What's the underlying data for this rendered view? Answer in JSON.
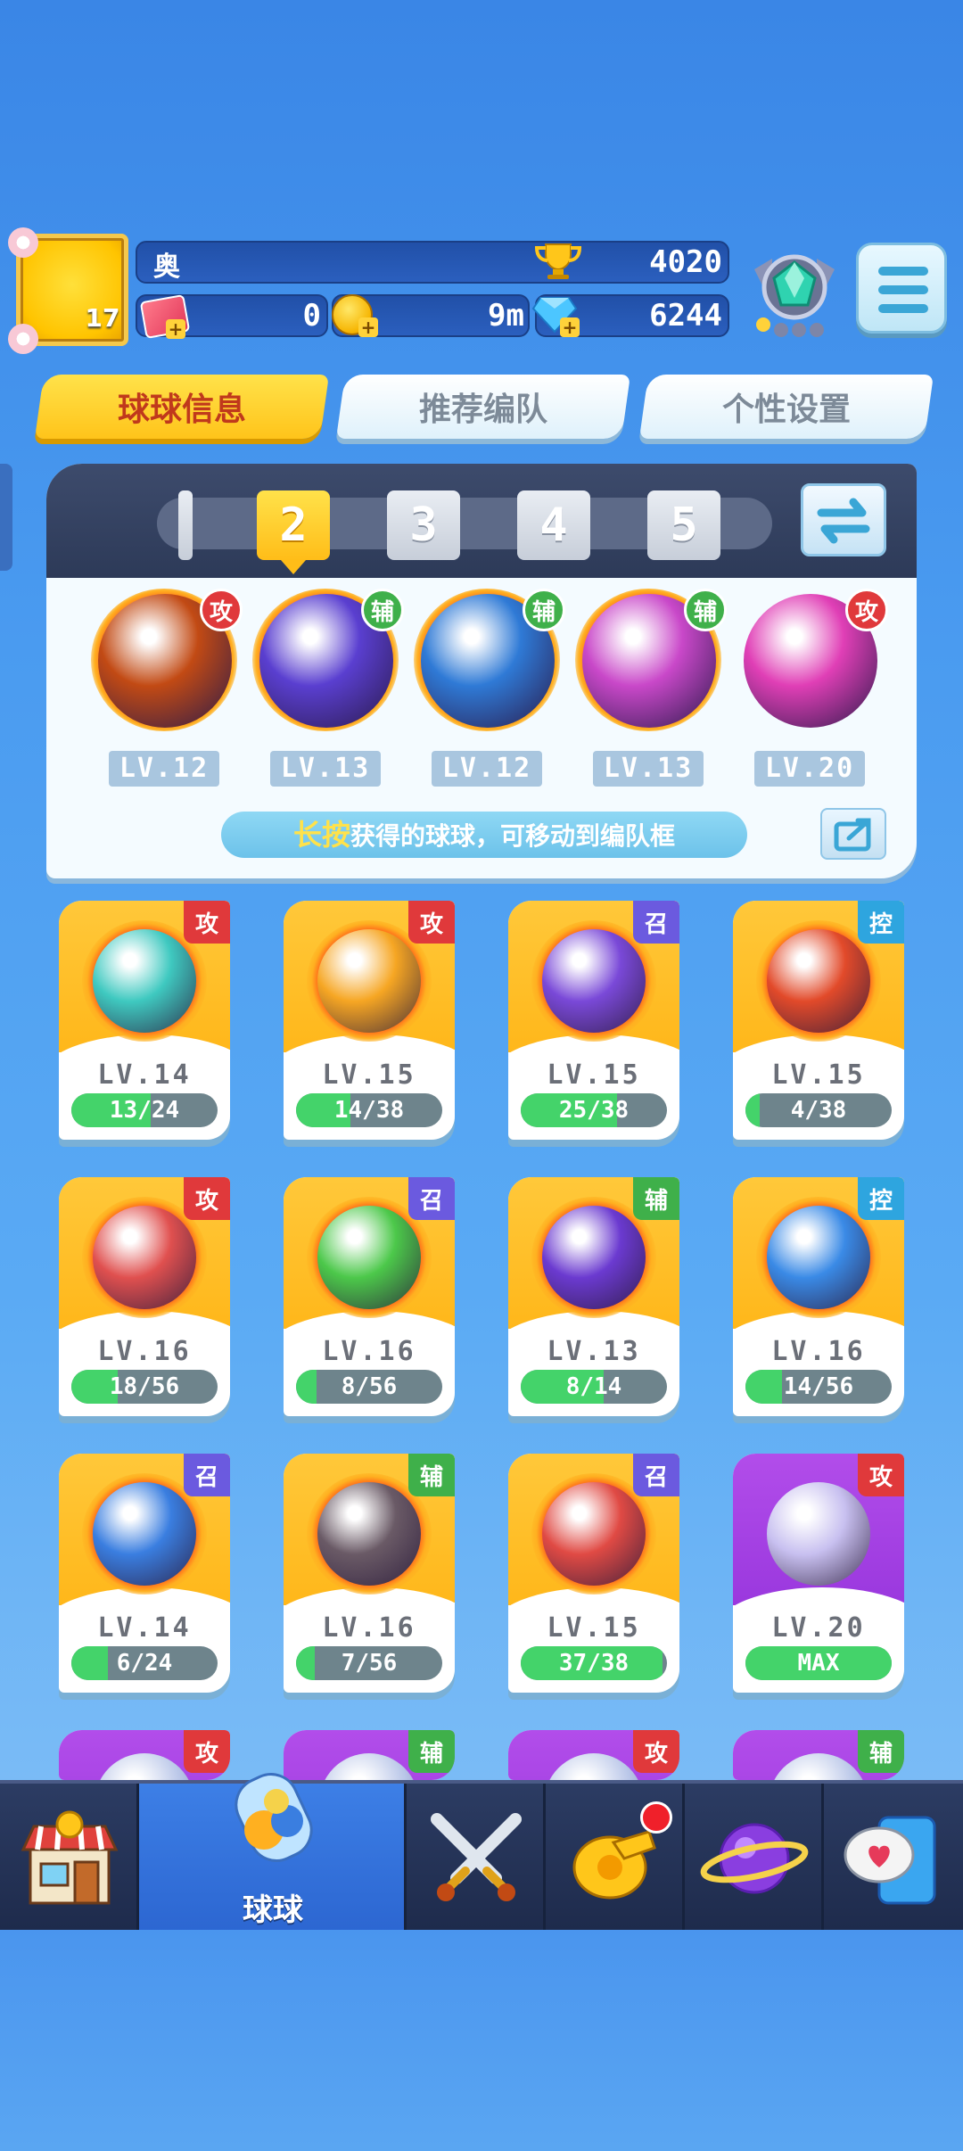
{
  "player": {
    "level": "17",
    "name": "奥",
    "trophies": "4020",
    "tickets": "0",
    "coins": "9m",
    "gems": "6244"
  },
  "tabs": [
    {
      "label": "球球信息",
      "active": true
    },
    {
      "label": "推荐编队",
      "active": false
    },
    {
      "label": "个性设置",
      "active": false
    }
  ],
  "team": {
    "slots": [
      "",
      "2",
      "3",
      "4",
      "5"
    ],
    "active_slot": "2",
    "members": [
      {
        "role": "攻",
        "level": "LV.12",
        "icon": "infinity-ball-icon",
        "color": "#c24a14"
      },
      {
        "role": "辅",
        "level": "LV.13",
        "icon": "lightning-ball-icon",
        "color": "#5a3fd0"
      },
      {
        "role": "辅",
        "level": "LV.12",
        "icon": "hexagon-planet-ball-icon",
        "color": "#2f7ad6"
      },
      {
        "role": "辅",
        "level": "LV.13",
        "icon": "crowd-ball-icon",
        "color": "#c948c9"
      },
      {
        "role": "攻",
        "level": "LV.20",
        "icon": "broken-shield-ball-icon",
        "color": "#e03fb6"
      }
    ],
    "hint_highlight": "长按",
    "hint_text": "获得的球球，可移动到编队框"
  },
  "cards": [
    {
      "role": "攻",
      "level": "LV.14",
      "progress": "13/24",
      "fill": 0.54,
      "icon": "tornado-ball-icon",
      "ball": "#3fc9c0",
      "bg": "yellow"
    },
    {
      "role": "攻",
      "level": "LV.15",
      "progress": "14/38",
      "fill": 0.37,
      "icon": "radiation-ball-icon",
      "ball": "#f6a623",
      "bg": "yellow"
    },
    {
      "role": "召",
      "level": "LV.15",
      "progress": "25/38",
      "fill": 0.66,
      "icon": "orbit-ball-icon",
      "ball": "#7a49d8",
      "bg": "yellow"
    },
    {
      "role": "控",
      "level": "LV.15",
      "progress": "4/38",
      "fill": 0.1,
      "icon": "gorilla-ball-icon",
      "ball": "#e24a2a",
      "bg": "yellow"
    },
    {
      "role": "攻",
      "level": "LV.16",
      "progress": "18/56",
      "fill": 0.32,
      "icon": "fist-ball-icon",
      "ball": "#e0504f",
      "bg": "yellow"
    },
    {
      "role": "召",
      "level": "LV.16",
      "progress": "8/56",
      "fill": 0.14,
      "icon": "star-ball-icon",
      "ball": "#4cc84a",
      "bg": "yellow"
    },
    {
      "role": "辅",
      "level": "LV.13",
      "progress": "8/14",
      "fill": 0.57,
      "icon": "sprout-ball-icon",
      "ball": "#6b3ad0",
      "bg": "yellow"
    },
    {
      "role": "控",
      "level": "LV.16",
      "progress": "14/56",
      "fill": 0.25,
      "icon": "snowflake-ball-icon",
      "ball": "#3a8ae6",
      "bg": "yellow"
    },
    {
      "role": "召",
      "level": "LV.14",
      "progress": "6/24",
      "fill": 0.25,
      "icon": "ice-castle-ball-icon",
      "ball": "#3a7ee0",
      "bg": "yellow"
    },
    {
      "role": "辅",
      "level": "LV.16",
      "progress": "7/56",
      "fill": 0.13,
      "icon": "skull-ball-icon",
      "ball": "#6a5a66",
      "bg": "yellow"
    },
    {
      "role": "召",
      "level": "LV.15",
      "progress": "37/38",
      "fill": 0.97,
      "icon": "cannon-ball-icon",
      "ball": "#e04a44",
      "bg": "yellow"
    },
    {
      "role": "攻",
      "level": "LV.20",
      "progress": "MAX",
      "fill": 1.0,
      "icon": "bubble-ball-icon",
      "ball": "#c8c0f0",
      "bg": "purple"
    }
  ],
  "partial_cards": [
    {
      "role": "攻"
    },
    {
      "role": "辅"
    },
    {
      "role": "攻"
    },
    {
      "role": "辅"
    }
  ],
  "nav": [
    {
      "label": "",
      "icon": "shop-icon"
    },
    {
      "label": "球球",
      "icon": "balls-jar-icon",
      "active": true
    },
    {
      "label": "",
      "icon": "crossed-swords-icon"
    },
    {
      "label": "",
      "icon": "whistle-icon",
      "badge": true
    },
    {
      "label": "",
      "icon": "planet-icon"
    },
    {
      "label": "",
      "icon": "chat-heart-icon"
    }
  ],
  "colors": {
    "attack": "#e0393b",
    "support": "#3fb04a",
    "summon": "#6b5adf",
    "control": "#2ea5df",
    "progress": "#44d36a"
  }
}
